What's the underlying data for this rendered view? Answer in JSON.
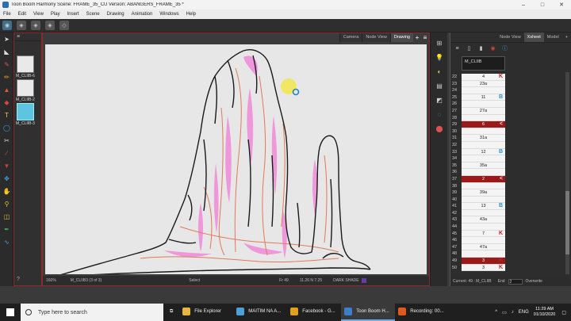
{
  "window": {
    "title": "Toon Boom Harmony Scene: FRAME_35_CU Version: ABANGERS_FRAME_35 *",
    "minimize": "–",
    "maximize": "□",
    "close": "✕"
  },
  "menu": [
    "File",
    "Edit",
    "View",
    "Play",
    "Insert",
    "Scene",
    "Drawing",
    "Animation",
    "Windows",
    "Help"
  ],
  "layers": [
    {
      "label": "M_CLIIB-6"
    },
    {
      "label": "M_CLIIB-2"
    },
    {
      "label": "M_CLIIB-3"
    }
  ],
  "viewport": {
    "tabs": [
      "Camera",
      "Node View",
      "Drawing"
    ],
    "active_tab": "Drawing",
    "status": {
      "zoom": "160%",
      "drawing": "M_CLIIB3 (3 of 3)",
      "tool": "Select",
      "frame": "Fr 49",
      "coords": "11.26 N 7.25",
      "palette": "DARK SHADE"
    }
  },
  "xsheet": {
    "tabs": [
      "Node View",
      "Xsheet",
      "Model"
    ],
    "active_tab": "Xsheet",
    "column_name": "M_CLIIB",
    "rows": [
      {
        "num": "22",
        "value": "4",
        "mark": "K",
        "red": false
      },
      {
        "num": "23",
        "value": "23a",
        "mark": "",
        "red": false
      },
      {
        "num": "24",
        "value": "",
        "mark": "",
        "red": false
      },
      {
        "num": "25",
        "value": "11",
        "mark": "B",
        "red": false
      },
      {
        "num": "26",
        "value": "",
        "mark": "",
        "red": false
      },
      {
        "num": "27",
        "value": "27a",
        "mark": "",
        "red": false
      },
      {
        "num": "28",
        "value": "",
        "mark": "",
        "red": false
      },
      {
        "num": "29",
        "value": "6",
        "mark": "<",
        "red": true
      },
      {
        "num": "30",
        "value": "",
        "mark": "",
        "red": false
      },
      {
        "num": "31",
        "value": "31a",
        "mark": "",
        "red": false
      },
      {
        "num": "32",
        "value": "",
        "mark": "",
        "red": false
      },
      {
        "num": "33",
        "value": "12",
        "mark": "B",
        "red": false
      },
      {
        "num": "34",
        "value": "",
        "mark": "",
        "red": false
      },
      {
        "num": "35",
        "value": "35a",
        "mark": "",
        "red": false
      },
      {
        "num": "36",
        "value": "",
        "mark": "",
        "red": false
      },
      {
        "num": "37",
        "value": "2",
        "mark": "<",
        "red": true
      },
      {
        "num": "38",
        "value": "",
        "mark": "",
        "red": false
      },
      {
        "num": "39",
        "value": "39a",
        "mark": "",
        "red": false
      },
      {
        "num": "40",
        "value": "",
        "mark": "",
        "red": false
      },
      {
        "num": "41",
        "value": "13",
        "mark": "B",
        "red": false
      },
      {
        "num": "42",
        "value": "",
        "mark": "",
        "red": false
      },
      {
        "num": "43",
        "value": "43a",
        "mark": "",
        "red": false
      },
      {
        "num": "44",
        "value": "",
        "mark": "",
        "red": false
      },
      {
        "num": "45",
        "value": "7",
        "mark": "K",
        "red": false
      },
      {
        "num": "46",
        "value": "",
        "mark": "",
        "red": false
      },
      {
        "num": "47",
        "value": "47a",
        "mark": "",
        "red": false
      },
      {
        "num": "48",
        "value": "",
        "mark": "",
        "red": false
      },
      {
        "num": "49",
        "value": "3",
        "mark": "K",
        "red": true
      },
      {
        "num": "50",
        "value": "3",
        "mark": "K",
        "red": false
      }
    ],
    "status": {
      "current": "Current: 49 : M_CLIIB",
      "end_label": "End",
      "end_value": "2",
      "overwrite": "Overwrite"
    }
  },
  "taskbar": {
    "search_placeholder": "Type here to search",
    "apps": [
      {
        "label": "File Explorer",
        "color": "#e8b640",
        "active": false
      },
      {
        "label": "MAITIM NA A...",
        "color": "#4aa0d8",
        "active": false
      },
      {
        "label": "Facebook - G...",
        "color": "#e0a020",
        "active": false
      },
      {
        "label": "Toon Boom H...",
        "color": "#3a7fc8",
        "active": true
      },
      {
        "label": "Recording: 00...",
        "color": "#e05a20",
        "active": false
      }
    ],
    "language": "ENG",
    "time": "11:29 AM",
    "date": "01/10/2020"
  }
}
